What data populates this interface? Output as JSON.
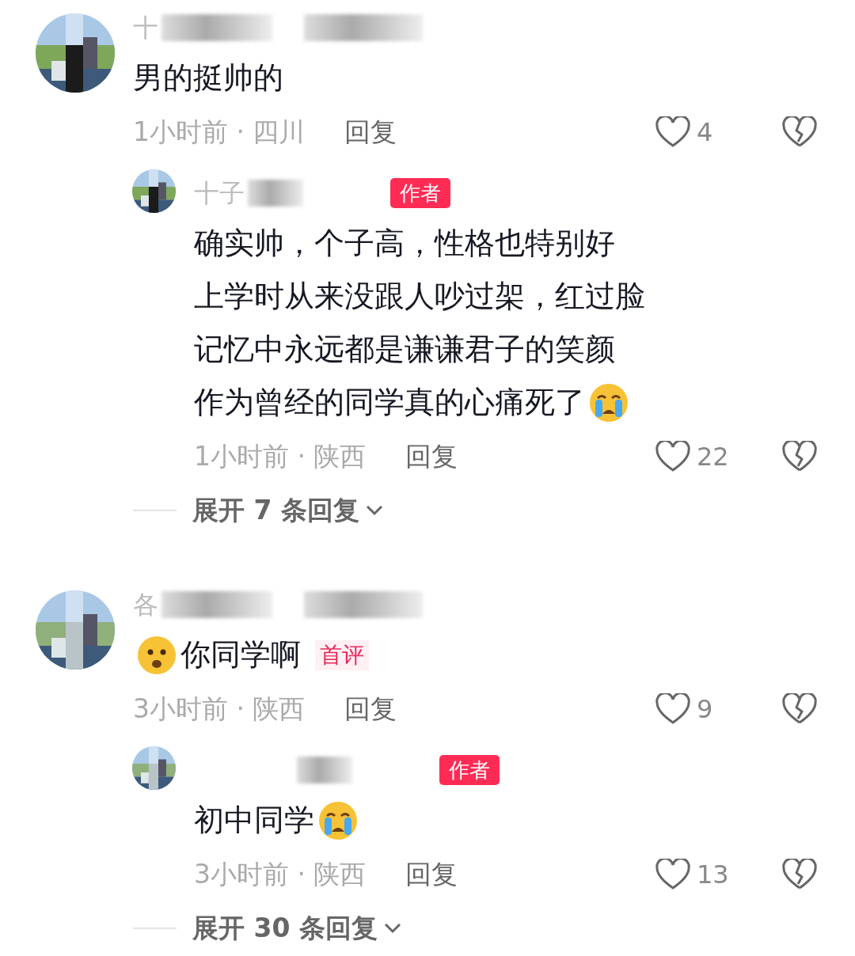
{
  "comments": [
    {
      "username": "十",
      "text_lines": [
        "男的挺帅的"
      ],
      "time_place": "1小时前 · 四川",
      "reply_label": "回复",
      "likes": "4",
      "replies": [
        {
          "username": "十子",
          "author_badge": "作者",
          "text_lines": [
            "确实帅，个子高，性格也特别好",
            "上学时从来没跟人吵过架，红过脸",
            "记忆中永远都是谦谦君子的笑颜",
            "作为曾经的同学真的心痛死了"
          ],
          "emoji_after": true,
          "time_place": "1小时前 · 陕西",
          "reply_label": "回复",
          "likes": "22"
        }
      ],
      "expand": "展开 7 条回复"
    },
    {
      "username": "各",
      "emoji_before": true,
      "text_lines": [
        "你同学啊"
      ],
      "first_badge": "首评",
      "time_place": "3小时前 · 陕西",
      "reply_label": "回复",
      "likes": "9",
      "replies": [
        {
          "author_badge": "作者",
          "text_lines": [
            "初中同学"
          ],
          "emoji_after": true,
          "time_place": "3小时前 · 陕西",
          "reply_label": "回复",
          "likes": "13"
        }
      ],
      "expand": "展开 30 条回复"
    }
  ]
}
